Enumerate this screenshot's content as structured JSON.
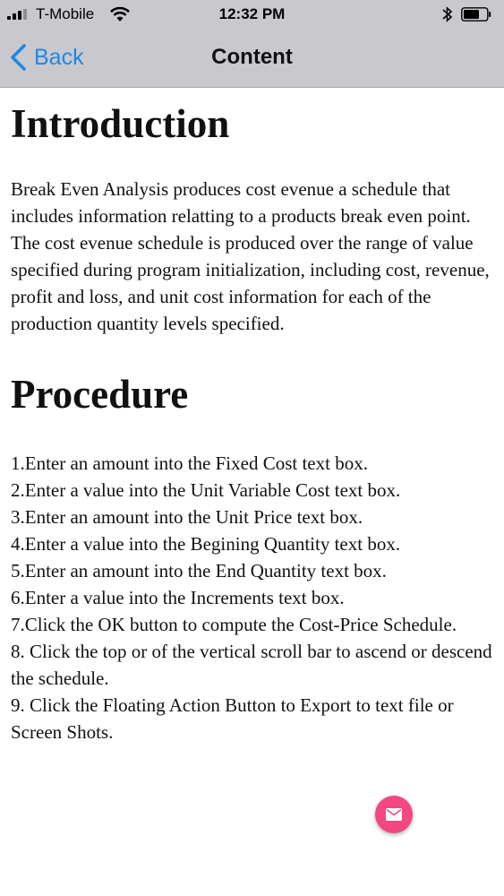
{
  "status_bar": {
    "carrier": "T-Mobile",
    "time": "12:32 PM"
  },
  "nav": {
    "back_label": "Back",
    "title": "Content"
  },
  "content": {
    "intro_heading": "Introduction",
    "intro_text": "Break Even Analysis produces cost evenue a schedule that includes information relatting to a products break even point. The cost evenue schedule is produced over the range of value specified during program initialization, including cost, revenue, profit and loss, and unit cost information for each of the production quantity levels specified.",
    "procedure_heading": "Procedure",
    "steps": [
      "1.Enter an amount into the Fixed Cost text box.",
      "2.Enter a value into the Unit Variable Cost text box.",
      "3.Enter an amount into the Unit Price text box.",
      "4.Enter a value into the Begining Quantity text box.",
      "5.Enter an amount into the End Quantity text box.",
      "6.Enter a value into the Increments text box.",
      "7.Click the OK button to compute the Cost-Price Schedule.",
      "8. Click the top or of the vertical scroll bar to ascend or descend the schedule.",
      "9. Click the Floating Action Button to Export to text file or Screen Shots."
    ]
  },
  "icons": {
    "back": "chevron-left-icon",
    "fab": "mail-icon",
    "wifi": "wifi-icon",
    "bluetooth": "bluetooth-icon",
    "battery": "battery-icon"
  },
  "colors": {
    "nav_background": "#c9c8cd",
    "accent_blue": "#1e88e5",
    "fab_pink": "#f24781"
  }
}
